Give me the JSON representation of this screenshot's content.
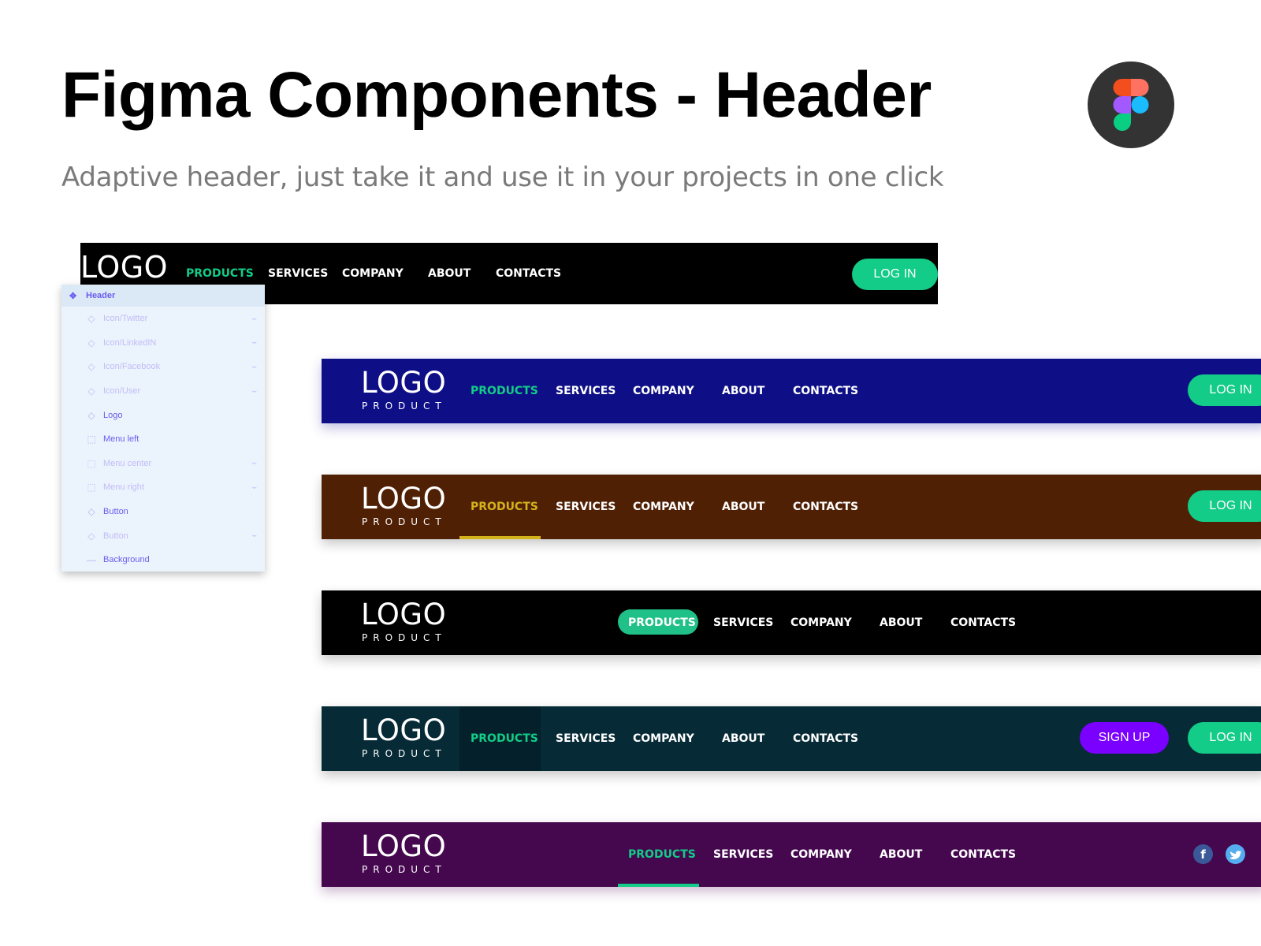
{
  "page": {
    "title": "Figma Components - Header",
    "subtitle": "Adaptive header, just take it and use it in your projects in one click",
    "badge_icon": "figma-logo-icon"
  },
  "colors": {
    "accent_green": "#12cc87",
    "active_yellow": "#d4b21a",
    "signup_purple": "#7a00ff",
    "facebook_blue": "#3b5998",
    "twitter_blue": "#55acee"
  },
  "nav": [
    "PRODUCTS",
    "SERVICES",
    "COMPANY",
    "ABOUT",
    "CONTACTS"
  ],
  "headers": [
    {
      "id": "black-basic",
      "bg": "#000000",
      "logo": "LOGO",
      "logo_sub": "",
      "active": "PRODUCTS",
      "active_style": "text-green",
      "buttons": [
        "LOG IN"
      ]
    },
    {
      "id": "navy",
      "bg": "#0e0f86",
      "logo": "LOGO",
      "logo_sub": "PRODUCT",
      "active": "PRODUCTS",
      "active_style": "text-green",
      "buttons": [
        "LOG IN"
      ]
    },
    {
      "id": "brown",
      "bg": "#502005",
      "logo": "LOGO",
      "logo_sub": "PRODUCT",
      "active": "PRODUCTS",
      "active_style": "text-yellow-underline",
      "buttons": [
        "LOG IN"
      ]
    },
    {
      "id": "black-centered",
      "bg": "#000000",
      "logo": "LOGO",
      "logo_sub": "PRODUCT",
      "active": "PRODUCTS",
      "active_style": "pill-green",
      "buttons": []
    },
    {
      "id": "teal",
      "bg": "#062a36",
      "logo": "LOGO",
      "logo_sub": "PRODUCT",
      "active": "PRODUCTS",
      "active_style": "text-green-darkbg",
      "buttons": [
        "SIGN UP",
        "LOG IN"
      ]
    },
    {
      "id": "purple",
      "bg": "#45084f",
      "logo": "LOGO",
      "logo_sub": "PRODUCT",
      "active": "PRODUCTS",
      "active_style": "text-green-underline",
      "buttons": [],
      "social": [
        "facebook-icon",
        "twitter-icon"
      ]
    }
  ],
  "layers": {
    "root": "Header",
    "items": [
      {
        "label": "Icon/Twitter",
        "type": "component",
        "visible": false
      },
      {
        "label": "Icon/LinkedIN",
        "type": "component",
        "visible": false
      },
      {
        "label": "Icon/Facebook",
        "type": "component",
        "visible": false
      },
      {
        "label": "Icon/User",
        "type": "component",
        "visible": false
      },
      {
        "label": "Logo",
        "type": "component",
        "visible": true
      },
      {
        "label": "Menu left",
        "type": "frame",
        "visible": true
      },
      {
        "label": "Menu center",
        "type": "frame",
        "visible": false
      },
      {
        "label": "Menu right",
        "type": "frame",
        "visible": false
      },
      {
        "label": "Button",
        "type": "component",
        "visible": true
      },
      {
        "label": "Button",
        "type": "component",
        "visible": false
      },
      {
        "label": "Background",
        "type": "line",
        "visible": true
      }
    ]
  }
}
